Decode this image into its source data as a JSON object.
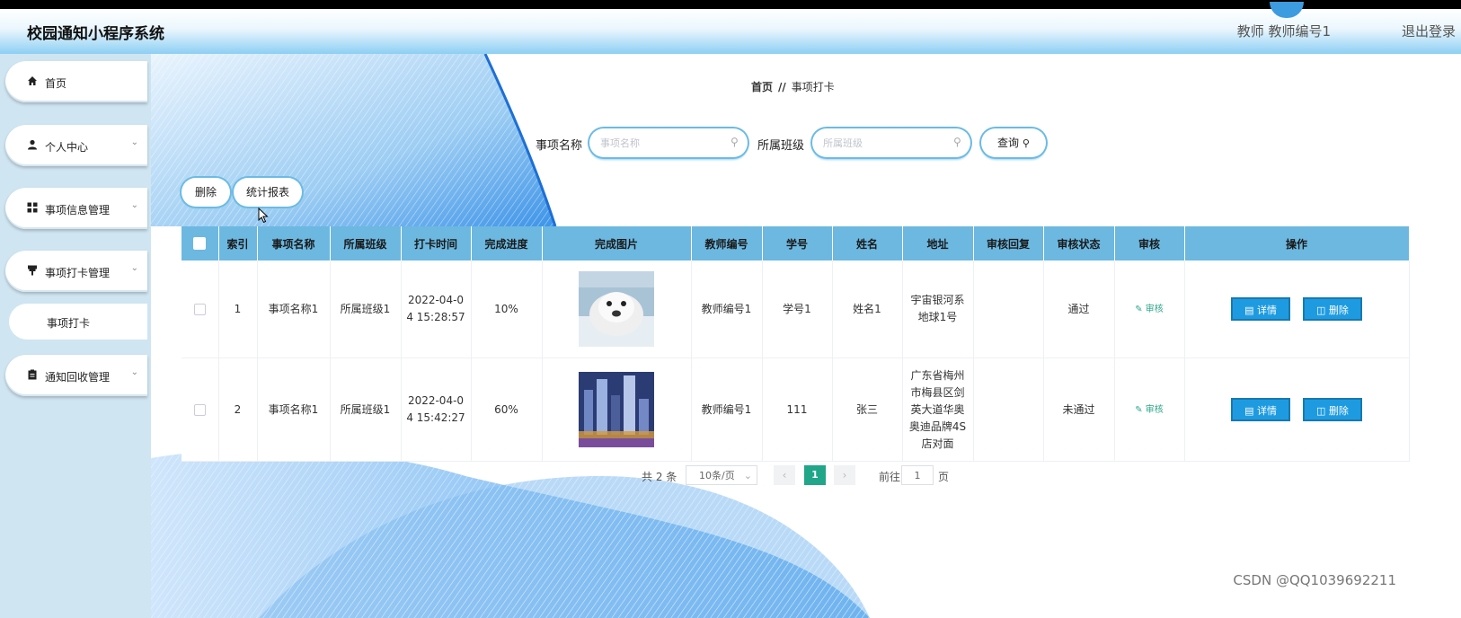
{
  "header": {
    "app_title": "校园通知小程序系统",
    "user_info": "教师 教师编号1",
    "logout_label": "退出登录"
  },
  "sidebar": {
    "items": [
      {
        "label": "首页",
        "icon": "home-icon"
      },
      {
        "label": "个人中心",
        "icon": "user-icon"
      },
      {
        "label": "事项信息管理",
        "icon": "grid-icon"
      },
      {
        "label": "事项打卡管理",
        "icon": "pin-icon"
      },
      {
        "label": "事项打卡",
        "icon": ""
      },
      {
        "label": "通知回收管理",
        "icon": "clipboard-icon"
      }
    ]
  },
  "breadcrumb": {
    "home": "首页",
    "separator": "//",
    "current": "事项打卡"
  },
  "search": {
    "name_label": "事项名称",
    "name_placeholder": "事项名称",
    "class_label": "所属班级",
    "class_placeholder": "所属班级",
    "query_label": "查询"
  },
  "toolbar": {
    "delete_label": "删除",
    "report_label": "统计报表"
  },
  "table": {
    "columns": [
      "索引",
      "事项名称",
      "所属班级",
      "打卡时间",
      "完成进度",
      "完成图片",
      "教师编号",
      "学号",
      "姓名",
      "地址",
      "审核回复",
      "审核状态",
      "审核",
      "操作"
    ],
    "rows": [
      {
        "index": "1",
        "name": "事项名称1",
        "class": "所属班级1",
        "time_line1": "2022-04-0",
        "time_line2": "4 15:28:57",
        "progress": "10%",
        "image": "seal-photo",
        "teacher_no": "教师编号1",
        "student_no": "学号1",
        "student_name": "姓名1",
        "address_lines": [
          "宇宙银河系",
          "地球1号"
        ],
        "audit_reply": "",
        "audit_status": "通过",
        "audit_action": "审核",
        "detail_label": "详情",
        "delete_label": "删除"
      },
      {
        "index": "2",
        "name": "事项名称1",
        "class": "所属班级1",
        "time_line1": "2022-04-0",
        "time_line2": "4 15:42:27",
        "progress": "60%",
        "image": "city-night-photo",
        "teacher_no": "教师编号1",
        "student_no": "111",
        "student_name": "张三",
        "address_lines": [
          "广东省梅州",
          "市梅县区剑",
          "英大道华奥",
          "奥迪品牌4S",
          "店对面"
        ],
        "audit_reply": "",
        "audit_status": "未通过",
        "audit_action": "审核",
        "detail_label": "详情",
        "delete_label": "删除"
      }
    ]
  },
  "pagination": {
    "total": "共 2 条",
    "page_size": "10条/页",
    "current_page": "1",
    "goto_prefix": "前往",
    "goto_value": "1",
    "goto_suffix": "页"
  },
  "watermark": "CSDN @QQ1039692211",
  "colors": {
    "header_gradient_end": "#8ccff3",
    "table_header": "#6cb8e0",
    "action_button": "#1e9be0",
    "pager_current": "#21a68a",
    "sidebar_bg": "#cfe5f1"
  }
}
